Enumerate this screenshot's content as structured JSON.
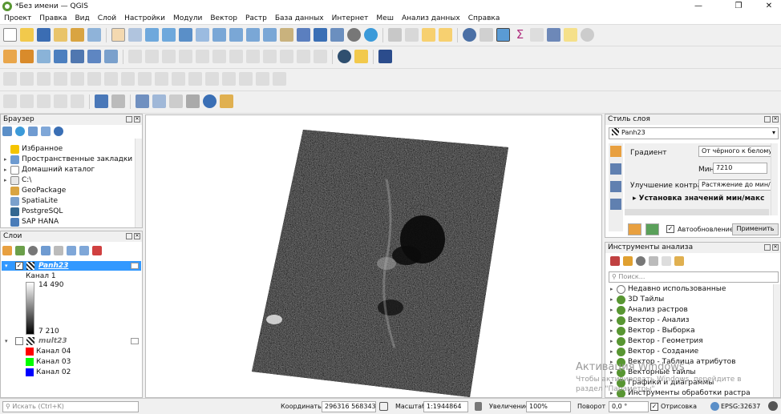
{
  "window": {
    "title": "*Без имени — QGIS",
    "minimize": "—",
    "maximize": "❐",
    "close": "✕"
  },
  "menu": [
    "Проект",
    "Правка",
    "Вид",
    "Слой",
    "Настройки",
    "Модули",
    "Вектор",
    "Растр",
    "База данных",
    "Интернет",
    "Меш",
    "Анализ данных",
    "Справка"
  ],
  "browser": {
    "title": "Браузер",
    "items": [
      {
        "label": "Избранное",
        "icon": "star-icon"
      },
      {
        "label": "Пространственные закладки",
        "icon": "bookmark-icon"
      },
      {
        "label": "Домашний каталог",
        "icon": "home-folder-icon"
      },
      {
        "label": "C:\\",
        "icon": "drive-icon"
      },
      {
        "label": "GeoPackage",
        "icon": "geopackage-icon"
      },
      {
        "label": "SpatiaLite",
        "icon": "spatialite-icon"
      },
      {
        "label": "PostgreSQL",
        "icon": "postgresql-icon"
      },
      {
        "label": "SAP HANA",
        "icon": "sap-hana-icon"
      }
    ]
  },
  "layers": {
    "title": "Слои",
    "panh": {
      "name": "Panh23",
      "band": "Канал 1",
      "max": "14 490",
      "min": "7 210"
    },
    "mult": {
      "name": "mult23",
      "bands": [
        {
          "label": "Канал 04",
          "color": "#ff0000"
        },
        {
          "label": "Канал 03",
          "color": "#00ff00"
        },
        {
          "label": "Канал 02",
          "color": "#0000ff"
        }
      ]
    }
  },
  "style": {
    "title": "Стиль слоя",
    "layer": "Panh23",
    "gradient_label": "Градиент",
    "gradient_value": "От чёрного к белому",
    "min_label": "Мин",
    "min_value": "7210",
    "contrast_label": "Улучшение контраста",
    "contrast_value": "Растяжение до мин/макс",
    "minmax_section": "Установка значений мин/макс",
    "autoupdate": "Автообновление",
    "apply": "Применить"
  },
  "processing": {
    "title": "Инструменты анализа",
    "search_placeholder": "Поиск...",
    "items": [
      "Недавно использованные",
      "3D Тайлы",
      "Анализ растров",
      "Вектор - Анализ",
      "Вектор - Выборка",
      "Вектор - Геометрия",
      "Вектор - Создание",
      "Вектор - Таблица атрибутов",
      "Векторные тайлы",
      "Графики и диаграммы",
      "Инструменты обработки растра"
    ]
  },
  "watermark": {
    "line1": "Активация Windows",
    "line2": "Чтобы активировать Windows, перейдите в",
    "line3": "раздел \"Параметры\"."
  },
  "status": {
    "search_placeholder": "Искать (Ctrl+K)",
    "coords_label": "Координаты",
    "coords_value": "296316  5683439",
    "scale_label": "Масштаб",
    "scale_value": "1:1944864",
    "magnify_label": "Увеличение",
    "magnify_value": "100%",
    "rotation_label": "Поворот",
    "rotation_value": "0,0 °",
    "render_label": "Отрисовка",
    "crs": "EPSG:32637"
  },
  "colors": {
    "qgis_green": "#589632",
    "selection": "#3399ff"
  }
}
